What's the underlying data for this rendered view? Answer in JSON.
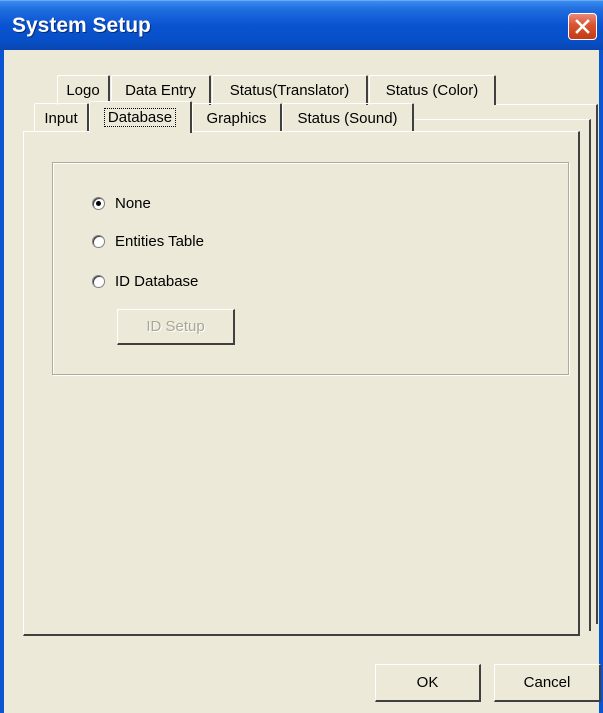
{
  "window": {
    "title": "System Setup",
    "close_icon": "close-icon"
  },
  "tabs_back_row": [
    {
      "label": "Logo"
    },
    {
      "label": "Data Entry"
    },
    {
      "label": "Status(Translator)"
    },
    {
      "label": "Status (Color)"
    }
  ],
  "tabs_front_row": [
    {
      "label": "Input"
    },
    {
      "label": "Database",
      "active": true
    },
    {
      "label": "Graphics"
    },
    {
      "label": "Status (Sound)"
    }
  ],
  "database": {
    "options": [
      {
        "label": "None",
        "selected": true
      },
      {
        "label": "Entities Table",
        "selected": false
      },
      {
        "label": "ID Database",
        "selected": false
      }
    ],
    "id_setup_label": "ID Setup"
  },
  "footer": {
    "ok_label": "OK",
    "cancel_label": "Cancel"
  }
}
